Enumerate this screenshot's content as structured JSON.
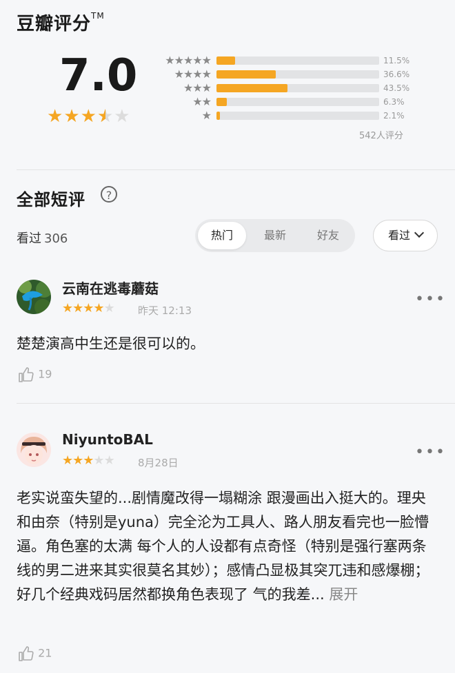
{
  "rating": {
    "title": "豆瓣评分",
    "tm": "TM",
    "score": "7.0",
    "stars": 3.5,
    "distribution": [
      {
        "stars": 5,
        "label": "★★★★★",
        "percent": 11.5,
        "percent_text": "11.5%"
      },
      {
        "stars": 4,
        "label": "★★★★",
        "percent": 36.6,
        "percent_text": "36.6%"
      },
      {
        "stars": 3,
        "label": "★★★",
        "percent": 43.5,
        "percent_text": "43.5%"
      },
      {
        "stars": 2,
        "label": "★★",
        "percent": 6.3,
        "percent_text": "6.3%"
      },
      {
        "stars": 1,
        "label": "★",
        "percent": 2.1,
        "percent_text": "2.1%"
      }
    ],
    "total": "542人评分",
    "accent_color": "#f5a623"
  },
  "short_comments": {
    "title": "全部短评",
    "help_icon": "?",
    "count_label": "看过",
    "count": "306",
    "tabs": [
      {
        "label": "热门",
        "active": true
      },
      {
        "label": "最新",
        "active": false
      },
      {
        "label": "好友",
        "active": false
      }
    ],
    "filter": "看过"
  },
  "comments": [
    {
      "user": "云南在逃毒蘑菇",
      "rating": 4,
      "time": "昨天 12:13",
      "text": "楚楚演高中生还是很可以的。",
      "likes": "19",
      "more": "•••"
    },
    {
      "user": "NiyuntoBAL",
      "rating": 3,
      "time": "8月28日",
      "text": "老实说蛮失望的...剧情魔改得一塌糊涂 跟漫画出入挺大的。理央和由奈（特别是yuna）完全沦为工具人、路人朋友看完也一脸懵逼。角色塞的太满 每个人的人设都有点奇怪（特别是强行塞两条线的男二进来其实很莫名其妙）；感情凸显极其突兀违和感爆棚；好几个经典戏码居然都换角色表现了 气的我差... ",
      "expand": "展开",
      "likes": "21",
      "more": "•••"
    }
  ]
}
